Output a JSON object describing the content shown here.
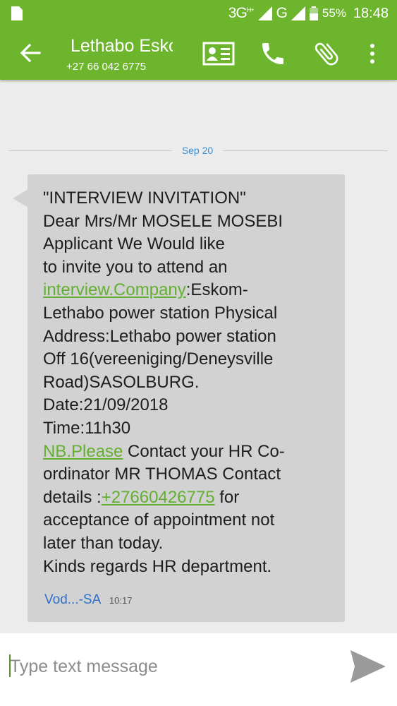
{
  "status_bar": {
    "sim_icon": "sim-card-icon",
    "network": "3G",
    "network_sup": "H+",
    "network2": "G",
    "battery_percent": "55%",
    "time": "18:48"
  },
  "header": {
    "back_icon": "arrow-left-icon",
    "contact_name": "Lethabo Eskom HR",
    "contact_number": "+27 66 042 6775",
    "actions": [
      "contact-card-icon",
      "phone-icon",
      "paperclip-icon",
      "more-vert-icon"
    ],
    "accent_color": "#6cb52d"
  },
  "conversation": {
    "date_divider": "Sep 20",
    "message": {
      "lines": [
        "\"INTERVIEW INVITATION\"",
        "Dear Mrs/Mr MOSELE MOSEBI",
        "Applicant We Would like",
        "to invite you to attend an",
        ":Eskom-",
        "Lethabo power station Physical",
        "Address:Lethabo power station",
        "Off 16(vereeniging/Deneysville",
        "Road)SASOLBURG.",
        "Date:21/09/2018",
        "Time:11h30",
        " Contact your HR Co-",
        "ordinator MR THOMAS Contact",
        "details :",
        " for",
        "acceptance of appointment not",
        "later than today.",
        "Kinds regards HR department."
      ],
      "links": {
        "company": "interview.Company",
        "nb": "NB.Please",
        "phone": "+27660426775"
      },
      "sender": "Vod...-SA",
      "time": "10:17"
    }
  },
  "compose": {
    "placeholder": "Type text message",
    "value": "",
    "send_icon": "send-icon"
  }
}
